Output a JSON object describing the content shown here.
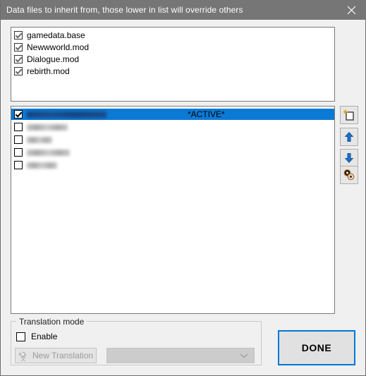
{
  "window": {
    "title": "Data files to inherit from, those lower in list will override others",
    "close_icon": "close-icon"
  },
  "inherit_list": {
    "items": [
      {
        "label": "gamedata.base",
        "checked": true
      },
      {
        "label": "Newwworld.mod",
        "checked": true
      },
      {
        "label": "Dialogue.mod",
        "checked": true
      },
      {
        "label": "rebirth.mod",
        "checked": true
      }
    ]
  },
  "files_list": {
    "active_tag": "*ACTIVE*",
    "items": [
      {
        "label": "",
        "checked": true,
        "selected": true,
        "redacted": true,
        "redacted_width": 113
      },
      {
        "label": "",
        "checked": false,
        "selected": false,
        "redacted": true,
        "redacted_width": 58
      },
      {
        "label": "",
        "checked": false,
        "selected": false,
        "redacted": true,
        "redacted_width": 36
      },
      {
        "label": "",
        "checked": false,
        "selected": false,
        "redacted": true,
        "redacted_width": 61
      },
      {
        "label": "",
        "checked": false,
        "selected": false,
        "redacted": true,
        "redacted_width": 43
      }
    ]
  },
  "toolbar": {
    "new_label": "new-file-icon",
    "up_label": "arrow-up-icon",
    "down_label": "arrow-down-icon",
    "clone_label": "clone-icon"
  },
  "translation": {
    "group_title": "Translation mode",
    "enable_label": "Enable",
    "enable_checked": false,
    "new_translation_label": "New Translation",
    "language_value": "",
    "language_placeholder": ""
  },
  "actions": {
    "done_label": "DONE"
  },
  "colors": {
    "titlebar": "#767676",
    "selection": "#0b7ad5",
    "accent": "#0078d7",
    "window_bg": "#f0f0f0"
  }
}
